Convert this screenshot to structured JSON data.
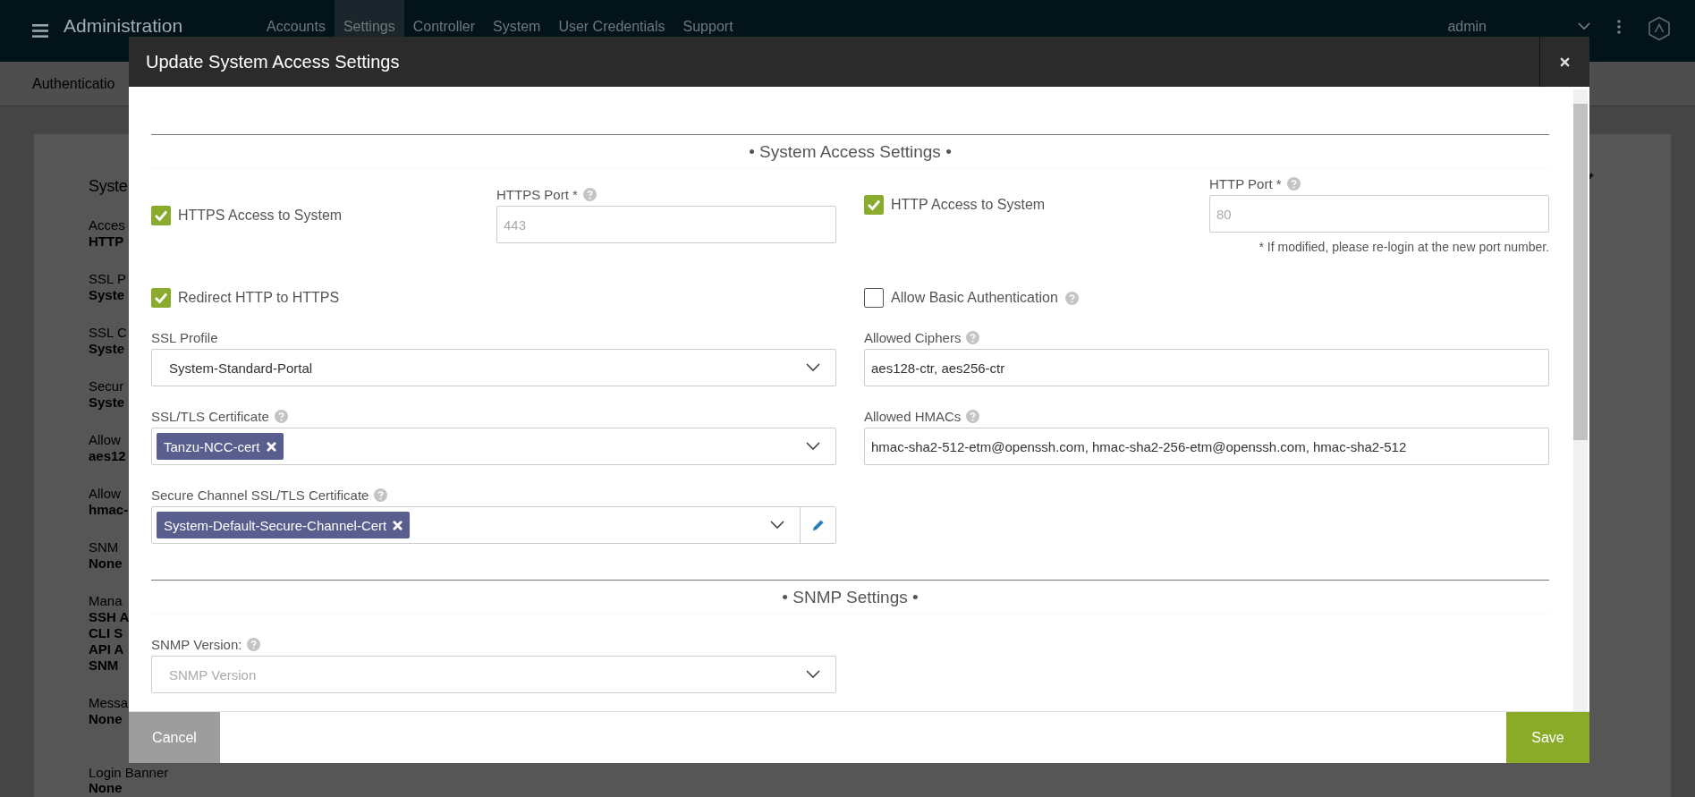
{
  "app_bar": {
    "title": "Administration",
    "nav": [
      {
        "label": "Accounts",
        "selected": false
      },
      {
        "label": "Settings",
        "selected": true
      },
      {
        "label": "Controller",
        "selected": false
      },
      {
        "label": "System",
        "selected": false
      },
      {
        "label": "User Credentials",
        "selected": false
      },
      {
        "label": "Support",
        "selected": false
      }
    ],
    "user": "admin"
  },
  "breadcrumb": "Authenticatio",
  "summary_card": {
    "title": "Syste",
    "items": [
      {
        "label": "Acces",
        "values": [
          "HTTP"
        ]
      },
      {
        "label": "SSL P",
        "values": [
          "Syste"
        ]
      },
      {
        "label": "SSL C",
        "values": [
          "Syste"
        ]
      },
      {
        "label": "Secur",
        "values": [
          "Syste"
        ]
      },
      {
        "label": "Allow",
        "values": [
          "aes12"
        ]
      },
      {
        "label": "Allow",
        "values": [
          "hmac-"
        ]
      },
      {
        "label": "SNM",
        "values": [
          "None"
        ]
      },
      {
        "label": "Mana",
        "values": [
          "SSH A",
          "CLI S",
          "API A",
          "SNM"
        ]
      },
      {
        "label": "Messa",
        "values": [
          "None"
        ]
      },
      {
        "label": "Login Banner",
        "values": [
          "None"
        ]
      }
    ]
  },
  "dialog": {
    "title": "Update System Access Settings",
    "access_heading": "• System Access Settings •",
    "https_access": {
      "label": "HTTPS Access to System",
      "checked": true
    },
    "https_port": {
      "label": "HTTPS Port *",
      "help": true,
      "value": "443",
      "disabled": true
    },
    "http_access": {
      "label": "HTTP Access to System",
      "checked": true
    },
    "http_port": {
      "label": "HTTP Port *",
      "help": true,
      "value": "80",
      "disabled": true
    },
    "port_note": "* If modified, please re-login at the new port number.",
    "redirect_http": {
      "label": "Redirect HTTP to HTTPS",
      "checked": true
    },
    "basic_auth": {
      "label": "Allow Basic Authentication",
      "checked": false,
      "help": true
    },
    "ssl_profile": {
      "label": "SSL Profile",
      "value": "System-Standard-Portal"
    },
    "allowed_ciphers": {
      "label": "Allowed Ciphers",
      "help": true,
      "value": "aes128-ctr, aes256-ctr"
    },
    "ssl_certificate": {
      "label": "SSL/TLS Certificate",
      "help": true,
      "tags": [
        "Tanzu-NCC-cert"
      ]
    },
    "allowed_hmacs": {
      "label": "Allowed HMACs",
      "help": true,
      "value": "hmac-sha2-512-etm@openssh.com, hmac-sha2-256-etm@openssh.com, hmac-sha2-512"
    },
    "secure_channel_certificate": {
      "label": "Secure Channel SSL/TLS Certificate",
      "help": true,
      "tags": [
        "System-Default-Secure-Channel-Cert"
      ]
    },
    "snmp_heading": "• SNMP Settings •",
    "snmp_version": {
      "label": "SNMP Version:",
      "help": true,
      "placeholder": "SNMP Version"
    },
    "buttons": {
      "cancel": "Cancel",
      "save": "Save"
    }
  }
}
